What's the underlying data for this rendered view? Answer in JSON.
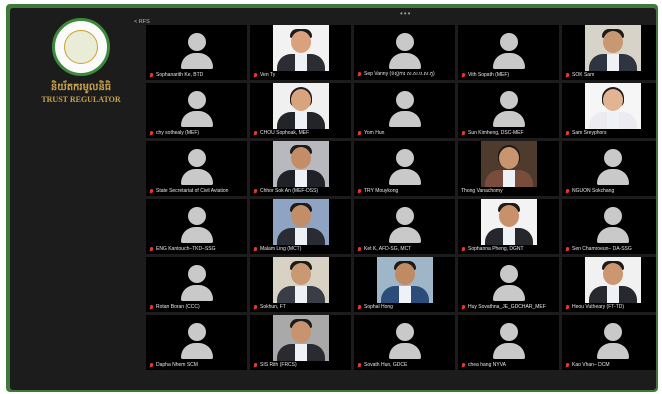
{
  "window": {
    "top_indicator": "•••",
    "gallery_label": "< RFS"
  },
  "branding": {
    "khmer_name": "និយ័តករមូលនិធិ",
    "english_name": "TRUST REGULATOR",
    "colors": {
      "gold": "#c8a34a",
      "green": "#3d8a3c"
    }
  },
  "participants": [
    {
      "name": "Sophanarith Ke, BTD",
      "video": false,
      "muted": true
    },
    {
      "name": "Ven Ty",
      "video": true,
      "skin": "#d9a27c",
      "hair": "short",
      "suit": "#2b2d33",
      "bg": "#f2f2f2",
      "muted": true
    },
    {
      "name": "Sep Vanny (ទីស្ដីការ ស.ស.ប.ស.កូ)",
      "video": false,
      "muted": true
    },
    {
      "name": "Vith Sopath (MEF)",
      "video": false,
      "muted": true
    },
    {
      "name": "SOK Sam",
      "video": true,
      "skin": "#c89873",
      "hair": "short",
      "suit": "#2f3540",
      "bg": "#d8d3c8",
      "muted": true
    },
    {
      "name": "chy sothealy (MEF)",
      "video": false,
      "muted": true
    },
    {
      "name": "CHOU Sophoak, MEF",
      "video": true,
      "skin": "#d8a47e",
      "hair": "long",
      "suit": "#232428",
      "bg": "#f0f0f0",
      "muted": true
    },
    {
      "name": "Yom Hun",
      "video": false,
      "muted": true
    },
    {
      "name": "Sun Kimheng, DSC-MEF",
      "video": false,
      "muted": true
    },
    {
      "name": "Sam Sreyphors",
      "video": true,
      "skin": "#e2b491",
      "hair": "long",
      "suit": "#ececf0",
      "bg": "#f6f6f6",
      "muted": true
    },
    {
      "name": "State Secretariat of Civil Aviation",
      "video": false,
      "muted": true
    },
    {
      "name": "Chhor Sok An (MEF-DSS)",
      "video": true,
      "skin": "#c48d68",
      "hair": "short",
      "suit": "#1f2126",
      "bg": "#b7b9bf",
      "muted": true
    },
    {
      "name": "TRY Mouykong",
      "video": false,
      "muted": true
    },
    {
      "name": "Thong Vanachomy",
      "video": true,
      "skin": "#c99570",
      "hair": "long",
      "suit": "#7a4c3b",
      "bg": "#4f3a2e",
      "muted": false
    },
    {
      "name": "NGUON Sokchang",
      "video": false,
      "muted": true
    },
    {
      "name": "ENG Kantouch–TKD–SSG",
      "video": false,
      "muted": true
    },
    {
      "name": "Malam Ling (MCT)",
      "video": true,
      "skin": "#c28e68",
      "hair": "short",
      "suit": "#2a2c34",
      "bg": "#8fa4c2",
      "muted": true
    },
    {
      "name": "Ket K, AFD-SG, MCT",
      "video": false,
      "muted": true
    },
    {
      "name": "Sophanna Pheng, DGNT",
      "video": true,
      "skin": "#c8916b",
      "hair": "short",
      "suit": "#25272d",
      "bg": "#f3f3f3",
      "muted": true
    },
    {
      "name": "Sen Chamroeun– DA-SSG",
      "video": false,
      "muted": true
    },
    {
      "name": "Rotan Boran (CCC)",
      "video": false,
      "muted": true
    },
    {
      "name": "Sokhun, FT",
      "video": true,
      "skin": "#c99974",
      "hair": "short",
      "suit": "#3a3d45",
      "bg": "#d7d2c4",
      "muted": true
    },
    {
      "name": "Sophal Hong",
      "video": true,
      "skin": "#c08a63",
      "hair": "short",
      "suit": "#2c4d7a",
      "bg": "#9fb6c9",
      "muted": true
    },
    {
      "name": "Huy Sovathna_JE_GDCHAR_MEF",
      "video": false,
      "muted": true
    },
    {
      "name": "Heou Vutheary (FT-TD)",
      "video": true,
      "skin": "#cb9670",
      "hair": "short",
      "suit": "#26282e",
      "bg": "#f1f1f1",
      "muted": true
    },
    {
      "name": "Dapha Nhem SCM",
      "video": false,
      "muted": true
    },
    {
      "name": "SIS Rith (FRCS)",
      "video": true,
      "skin": "#c7946f",
      "hair": "short",
      "suit": "#2a2b30",
      "bg": "#a9a9a9",
      "muted": true
    },
    {
      "name": "Sovath Hun, GDCE",
      "video": false,
      "muted": true
    },
    {
      "name": "chea hang NYVA",
      "video": false,
      "muted": true
    },
    {
      "name": "Kao Vhan– DCM",
      "video": false,
      "muted": true
    }
  ]
}
